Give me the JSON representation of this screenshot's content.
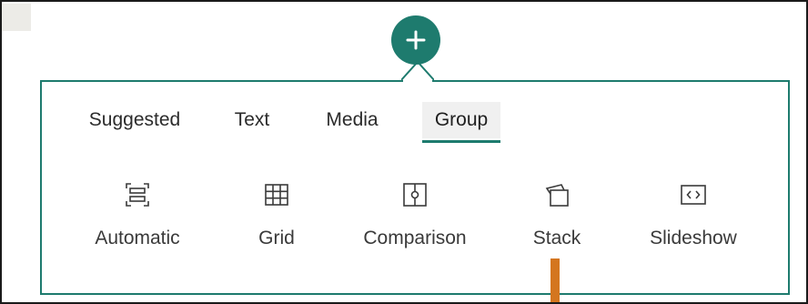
{
  "add_button": {
    "label": "+"
  },
  "tabs": [
    {
      "label": "Suggested",
      "active": false
    },
    {
      "label": "Text",
      "active": false
    },
    {
      "label": "Media",
      "active": false
    },
    {
      "label": "Group",
      "active": true
    }
  ],
  "layouts": [
    {
      "label": "Automatic",
      "icon": "automatic-layout-icon"
    },
    {
      "label": "Grid",
      "icon": "grid-layout-icon"
    },
    {
      "label": "Comparison",
      "icon": "comparison-layout-icon"
    },
    {
      "label": "Stack",
      "icon": "stack-layout-icon"
    },
    {
      "label": "Slideshow",
      "icon": "slideshow-layout-icon"
    }
  ],
  "colors": {
    "accent": "#1e7b6e",
    "pointer": "#d4761f",
    "active_tab_bg": "#f0f0f0"
  }
}
